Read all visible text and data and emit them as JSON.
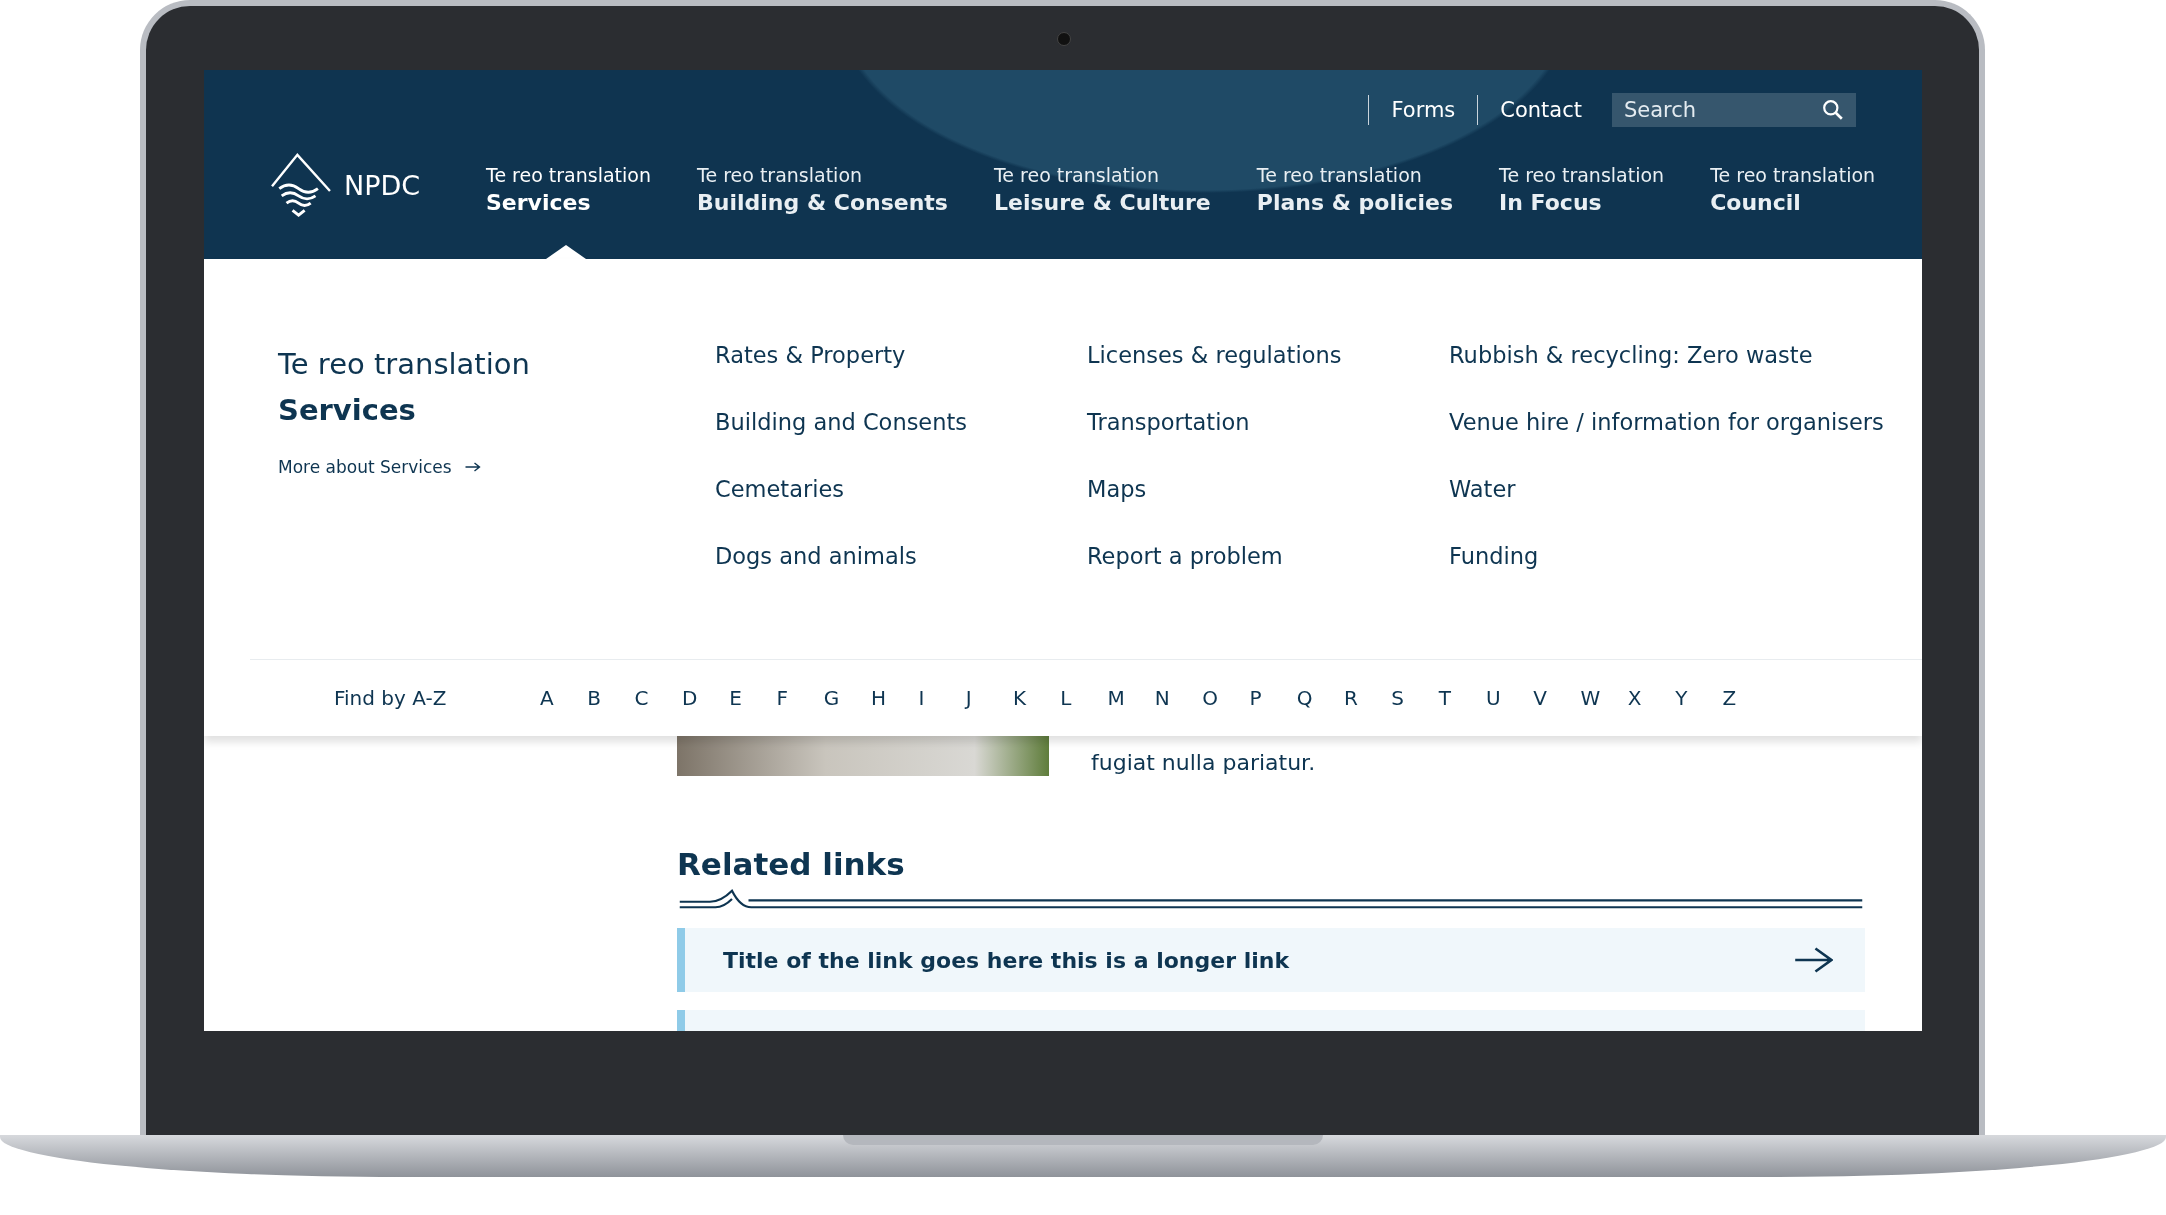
{
  "utility_links": [
    {
      "label": "Forms"
    },
    {
      "label": "Contact"
    }
  ],
  "search": {
    "placeholder": "Search"
  },
  "logo": {
    "text": "NPDC"
  },
  "nav": [
    {
      "kicker": "Te reo translation",
      "label": "Services",
      "selected": true
    },
    {
      "kicker": "Te reo translation",
      "label": "Building & Consents",
      "selected": false
    },
    {
      "kicker": "Te reo translation",
      "label": "Leisure & Culture",
      "selected": false
    },
    {
      "kicker": "Te reo translation",
      "label": "Plans & policies",
      "selected": false
    },
    {
      "kicker": "Te reo translation",
      "label": "In Focus",
      "selected": false
    },
    {
      "kicker": "Te reo translation",
      "label": "Council",
      "selected": false
    }
  ],
  "mega_menu": {
    "kicker": "Te reo translation",
    "title": "Services",
    "more_link": "More about Services",
    "columns": [
      [
        "Rates & Property",
        "Building and Consents",
        "Cemetaries",
        "Dogs and animals"
      ],
      [
        "Licenses & regulations",
        "Transportation",
        "Maps",
        "Report a problem"
      ],
      [
        "Rubbish & recycling: Zero waste",
        "Venue hire / information for organisers",
        "Water",
        "Funding"
      ]
    ]
  },
  "az": {
    "label": "Find by A-Z",
    "letters": [
      "A",
      "B",
      "C",
      "D",
      "E",
      "F",
      "G",
      "H",
      "I",
      "J",
      "K",
      "L",
      "M",
      "N",
      "O",
      "P",
      "Q",
      "R",
      "S",
      "T",
      "U",
      "V",
      "W",
      "X",
      "Y",
      "Z"
    ]
  },
  "content": {
    "paragraph_end": "fugiat nulla pariatur."
  },
  "related_links": {
    "heading": "Related links",
    "items": [
      "Title of the link goes here this is a longer link"
    ]
  }
}
